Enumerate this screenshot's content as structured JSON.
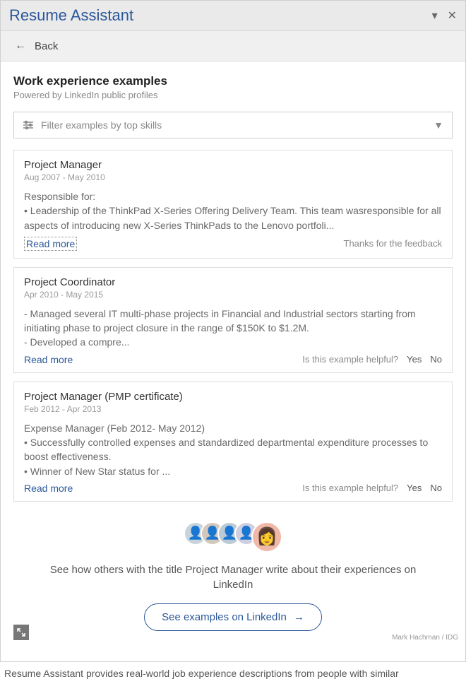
{
  "titlebar": {
    "title": "Resume Assistant"
  },
  "subheader": {
    "back_label": "Back"
  },
  "section": {
    "title": "Work experience examples",
    "powered": "Powered by LinkedIn public profiles"
  },
  "filter": {
    "placeholder": "Filter examples by top skills"
  },
  "examples": [
    {
      "title": "Project Manager",
      "dates": "Aug 2007 - May 2010",
      "desc": "Responsible for:\n• Leadership of the ThinkPad X-Series Offering Delivery Team. This team wasresponsible for all aspects of introducing new X-Series ThinkPads to the Lenovo portfoli...",
      "read_more": "Read more",
      "feedback_text": "Thanks for the feedback",
      "show_yesno": false
    },
    {
      "title": "Project Coordinator",
      "dates": "Apr 2010 - May 2015",
      "desc": "- Managed several IT multi-phase projects in Financial and Industrial sectors starting from initiating phase to project closure in the range of $150K to $1.2M.\n- Developed a compre...",
      "read_more": "Read more",
      "feedback_text": "Is this example helpful?",
      "show_yesno": true
    },
    {
      "title": "Project Manager (PMP certificate)",
      "dates": "Feb 2012 - Apr 2013",
      "desc": "Expense Manager (Feb 2012- May 2012)\n• Successfully controlled expenses and standardized departmental expenditure processes to boost effectiveness.\n• Winner of New Star status for ...",
      "read_more": "Read more",
      "feedback_text": "Is this example helpful?",
      "show_yesno": true
    }
  ],
  "promo": {
    "text": "See how others with the title Project Manager write about their experiences on LinkedIn",
    "button": "See examples on LinkedIn"
  },
  "yes_label": "Yes",
  "no_label": "No",
  "credit": "Mark Hachman / IDG",
  "caption": "Resume Assistant provides real-world job experience descriptions from people with similar"
}
